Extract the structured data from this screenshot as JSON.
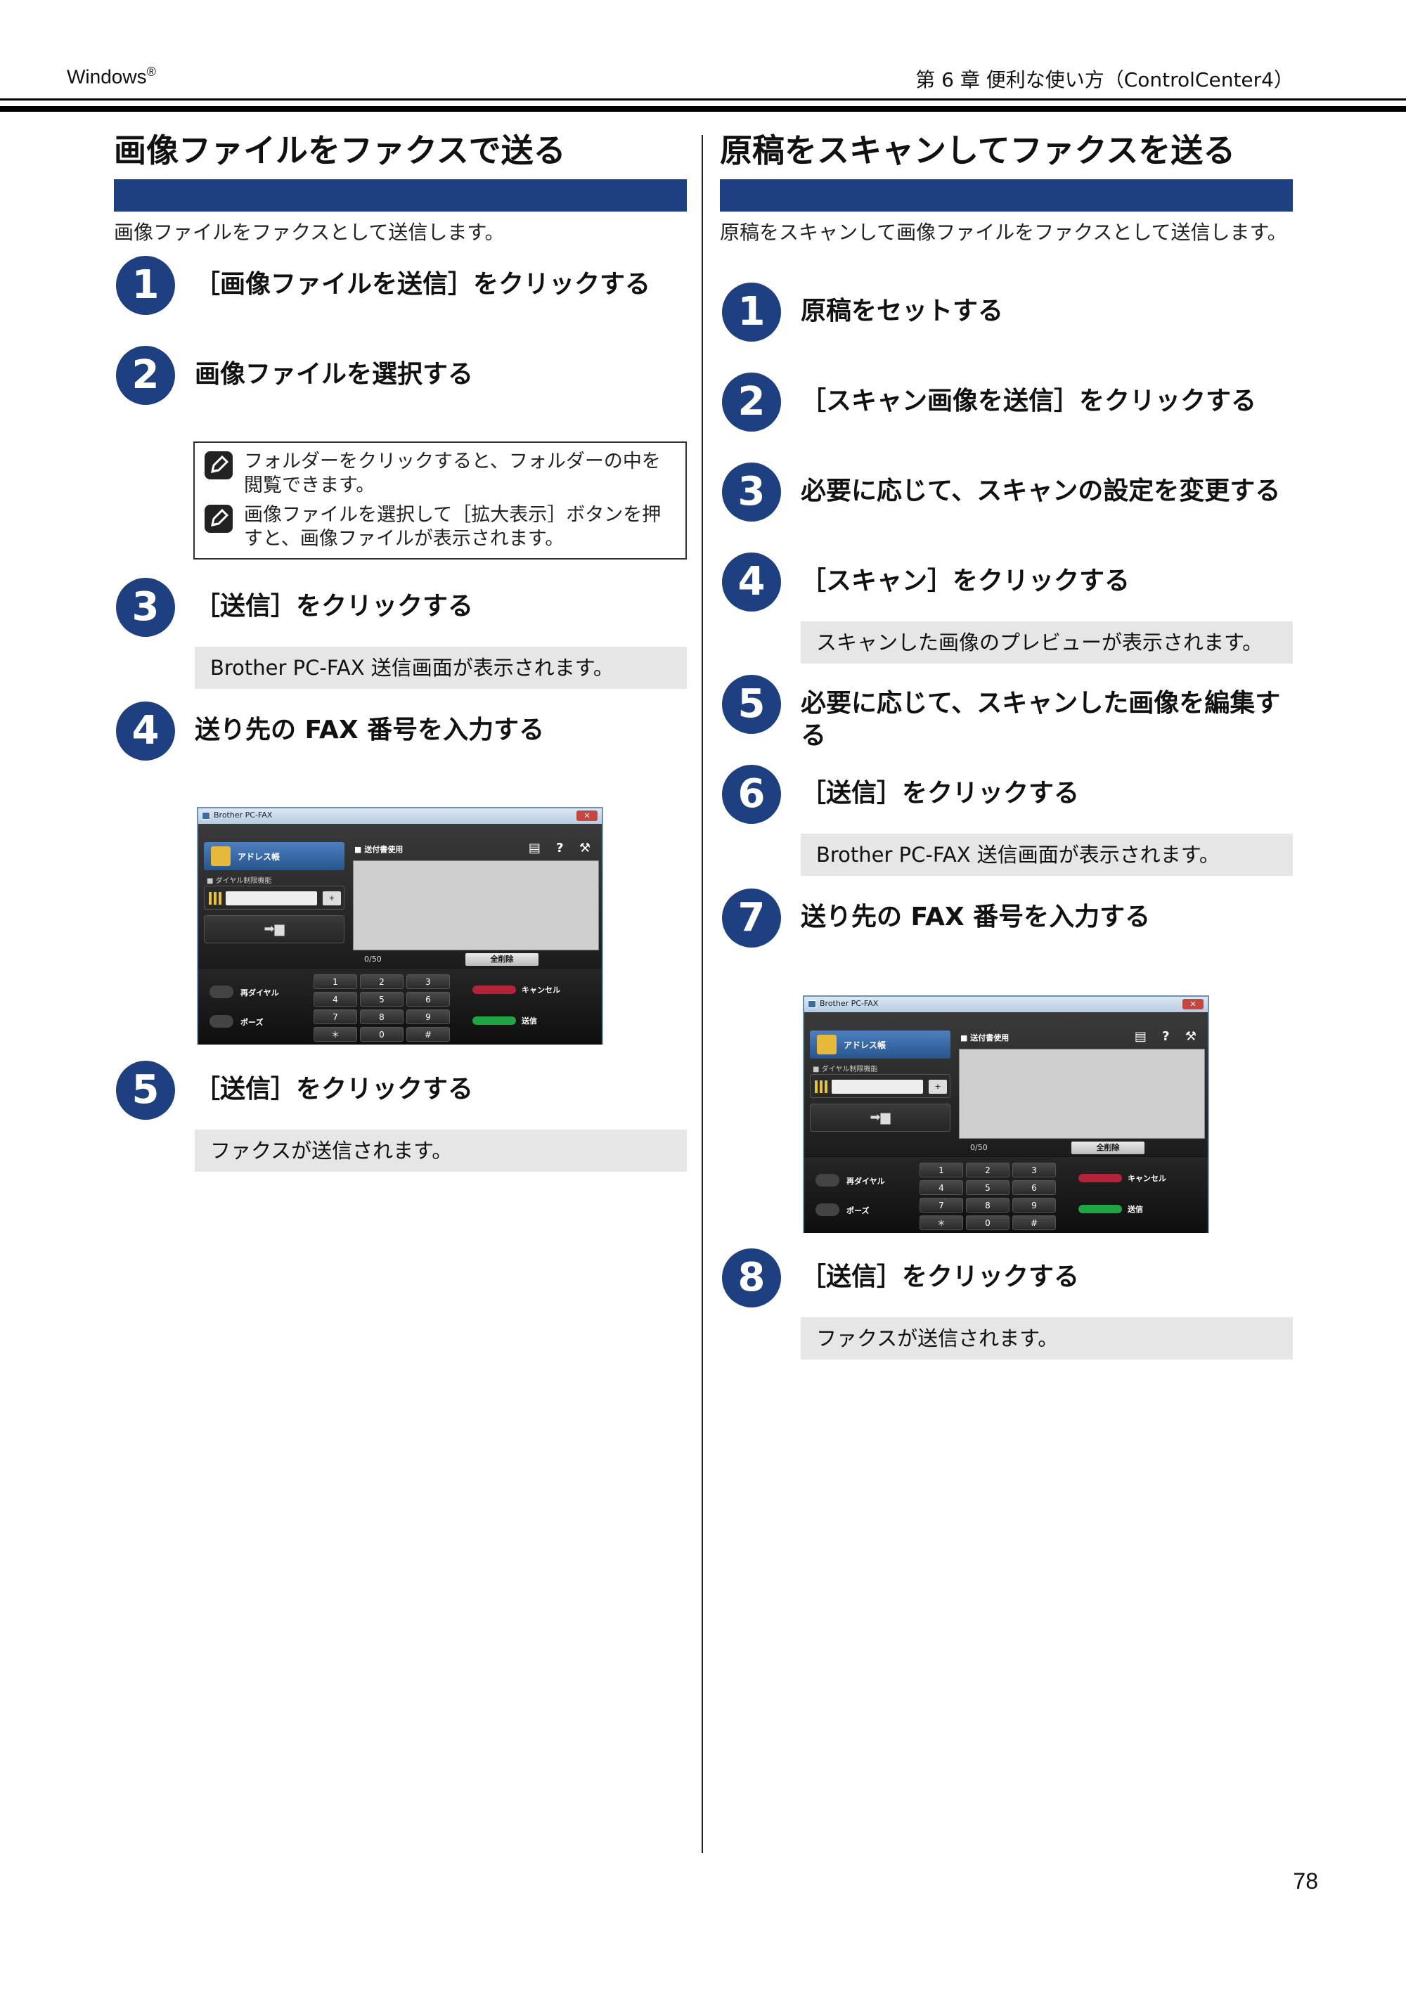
{
  "header": {
    "left": "Windows",
    "left_mark": "®",
    "right": "第 6 章 便利な使い方（ControlCenter4）"
  },
  "page_number": "78",
  "left_section": {
    "title": "画像ファイルをファクスで送る",
    "intro": "画像ファイルをファクスとして送信します。",
    "steps": [
      {
        "num": "1",
        "text": "［画像ファイルを送信］をクリックする"
      },
      {
        "num": "2",
        "text": "画像ファイルを選択する",
        "notes": [
          "フォルダーをクリックすると、フォルダーの中を閲覧できます。",
          "画像ファイルを選択して［拡大表示］ボタンを押すと、画像ファイルが表示されます。"
        ]
      },
      {
        "num": "3",
        "text": "［送信］をクリックする",
        "info": "Brother PC-FAX 送信画面が表示されます。"
      },
      {
        "num": "4",
        "text": "送り先の FAX 番号を入力する"
      },
      {
        "num": "5",
        "text": "［送信］をクリックする",
        "info": "ファクスが送信されます。"
      }
    ]
  },
  "right_section": {
    "title": "原稿をスキャンしてファクスを送る",
    "intro": "原稿をスキャンして画像ファイルをファクスとして送信します。",
    "steps": [
      {
        "num": "1",
        "text": "原稿をセットする"
      },
      {
        "num": "2",
        "text": "［スキャン画像を送信］をクリックする"
      },
      {
        "num": "3",
        "text": "必要に応じて、スキャンの設定を変更する"
      },
      {
        "num": "4",
        "text": "［スキャン］をクリックする",
        "info": "スキャンした画像のプレビューが表示されます。"
      },
      {
        "num": "5",
        "text": "必要に応じて、スキャンした画像を編集する"
      },
      {
        "num": "6",
        "text": "［送信］をクリックする",
        "info": "Brother PC-FAX 送信画面が表示されます。"
      },
      {
        "num": "7",
        "text": "送り先の FAX 番号を入力する"
      },
      {
        "num": "8",
        "text": "［送信］をクリックする",
        "info": "ファクスが送信されます。"
      }
    ]
  },
  "fax_window": {
    "title": "Brother PC-FAX",
    "close": "✕",
    "address_book": "アドレス帳",
    "dial_lock": "■ ダイヤル制限機能",
    "plus": "+",
    "send_arrow": "➡▆",
    "cover_sheet": "■ 送付書使用",
    "top_icons": "▤ ? ⚒",
    "count": "0/50",
    "clear_all": "全削除",
    "keys": [
      "1",
      "2",
      "3",
      "4",
      "5",
      "6",
      "7",
      "8",
      "9",
      "＊",
      "0",
      "#"
    ],
    "redial": "再ダイヤル",
    "pause": "ポーズ",
    "cancel": "キャンセル",
    "send": "送信",
    "colors": {
      "cancel_led": "#b3233a",
      "send_led": "#20a545",
      "frame": "#141414"
    }
  },
  "colors": {
    "accent": "#1f4080",
    "info_bg": "#e6e6e6"
  }
}
